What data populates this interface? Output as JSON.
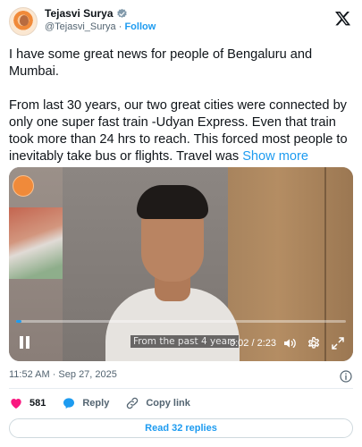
{
  "header": {
    "display_name": "Tejasvi Surya",
    "handle": "@Tejasvi_Surya",
    "separator": "·",
    "follow_label": "Follow"
  },
  "tweet": {
    "paragraph_1": "I have some great news for people of Bengaluru and Mumbai.",
    "paragraph_2": "From last 30 years, our two great cities were connected by only one super fast train -Udyan Express. Even that train took more than 24 hrs to reach. This forced most people to inevitably take bus or flights. Travel was",
    "show_more_label": "Show more"
  },
  "video": {
    "caption": "From the past 4 years",
    "time": "0:02 / 2:23",
    "progress_percent": 1.5
  },
  "meta": {
    "timestamp": "11:52 AM · Sep 27, 2025"
  },
  "actions": {
    "likes": "581",
    "reply_label": "Reply",
    "copy_link_label": "Copy link"
  },
  "footer": {
    "read_replies_label": "Read 32 replies"
  },
  "colors": {
    "accent": "#1d9bf0",
    "like": "#f91880",
    "text": "#0f1419",
    "muted": "#536471"
  },
  "icons": [
    "verified-badge-icon",
    "x-logo-icon",
    "pause-icon",
    "volume-icon",
    "gear-icon",
    "expand-icon",
    "info-icon",
    "heart-icon",
    "reply-icon",
    "link-icon"
  ]
}
